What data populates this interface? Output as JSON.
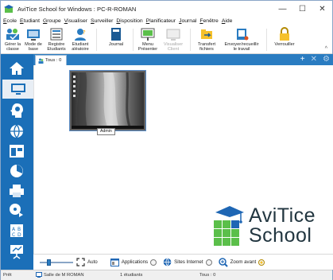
{
  "window": {
    "title": "AviTice School for Windows : PC-R-ROMAN",
    "minimize": "—",
    "maximize": "☐",
    "close": "✕"
  },
  "menu": [
    {
      "label": "Ecole",
      "mnemonic": "E"
    },
    {
      "label": "Etudiant",
      "mnemonic": "E"
    },
    {
      "label": "Groupe",
      "mnemonic": "G"
    },
    {
      "label": "Visualiser",
      "mnemonic": "V"
    },
    {
      "label": "Surveiller",
      "mnemonic": "S"
    },
    {
      "label": "Disposition",
      "mnemonic": "D"
    },
    {
      "label": "Planificateur",
      "mnemonic": "P"
    },
    {
      "label": "Journal",
      "mnemonic": "J"
    },
    {
      "label": "Fenêtre",
      "mnemonic": "F"
    },
    {
      "label": "Aide",
      "mnemonic": "A"
    }
  ],
  "ribbon": [
    {
      "label1": "Gérer la",
      "label2": "classe",
      "icon": "class-manage-icon"
    },
    {
      "label1": "Mode de",
      "label2": "base",
      "icon": "base-mode-icon"
    },
    {
      "label1": "Registre",
      "label2": "Etudiants",
      "icon": "student-register-icon"
    },
    {
      "label1": "Etudiant",
      "label2": "aléatoire",
      "icon": "random-student-icon"
    },
    {
      "label1": "Journal",
      "label2": "",
      "icon": "journal-icon"
    },
    {
      "label1": "Menu",
      "label2": "Présenter",
      "icon": "present-menu-icon"
    },
    {
      "label1": "Visualiser",
      "label2": "Client",
      "icon": "view-client-icon",
      "disabled": true
    },
    {
      "label1": "Transfert",
      "label2": "fichiers",
      "icon": "file-transfer-icon"
    },
    {
      "label1": "Envoyer/recueillir",
      "label2": "le travail",
      "icon": "send-collect-icon"
    },
    {
      "label1": "Verrouiller",
      "label2": "",
      "icon": "lock-icon"
    }
  ],
  "ribbon_collapse": "^",
  "tabs": {
    "active_label": "Tous : 0",
    "add": "+",
    "close": "✕",
    "settings": "⚙"
  },
  "sidebar": [
    {
      "name": "home-icon"
    },
    {
      "name": "monitor-icon",
      "active": true
    },
    {
      "name": "head-profile-icon"
    },
    {
      "name": "globe-icon"
    },
    {
      "name": "window-layout-icon"
    },
    {
      "name": "pie-chart-icon"
    },
    {
      "name": "printer-icon"
    },
    {
      "name": "media-icon"
    },
    {
      "name": "exam-icon"
    },
    {
      "name": "presentation-icon"
    }
  ],
  "thumbnail": {
    "label": "Admin"
  },
  "logo": {
    "line1": "AviTice",
    "line2": "School"
  },
  "controls": {
    "slider_value_fraction": 0.25,
    "auto": "Auto",
    "applications": "Applications",
    "websites": "Sites Internet",
    "zoom": "Zoom avant"
  },
  "status": {
    "state": "Prêt",
    "room": "Salle de M ROMAN",
    "students": "1 étudiants",
    "all": "Tous : 0"
  },
  "colors": {
    "accent": "#1b6fb8",
    "tabstrip": "#2a7cc1",
    "logo_green": "#5bbf4a",
    "logo_blue": "#1e66b4"
  }
}
